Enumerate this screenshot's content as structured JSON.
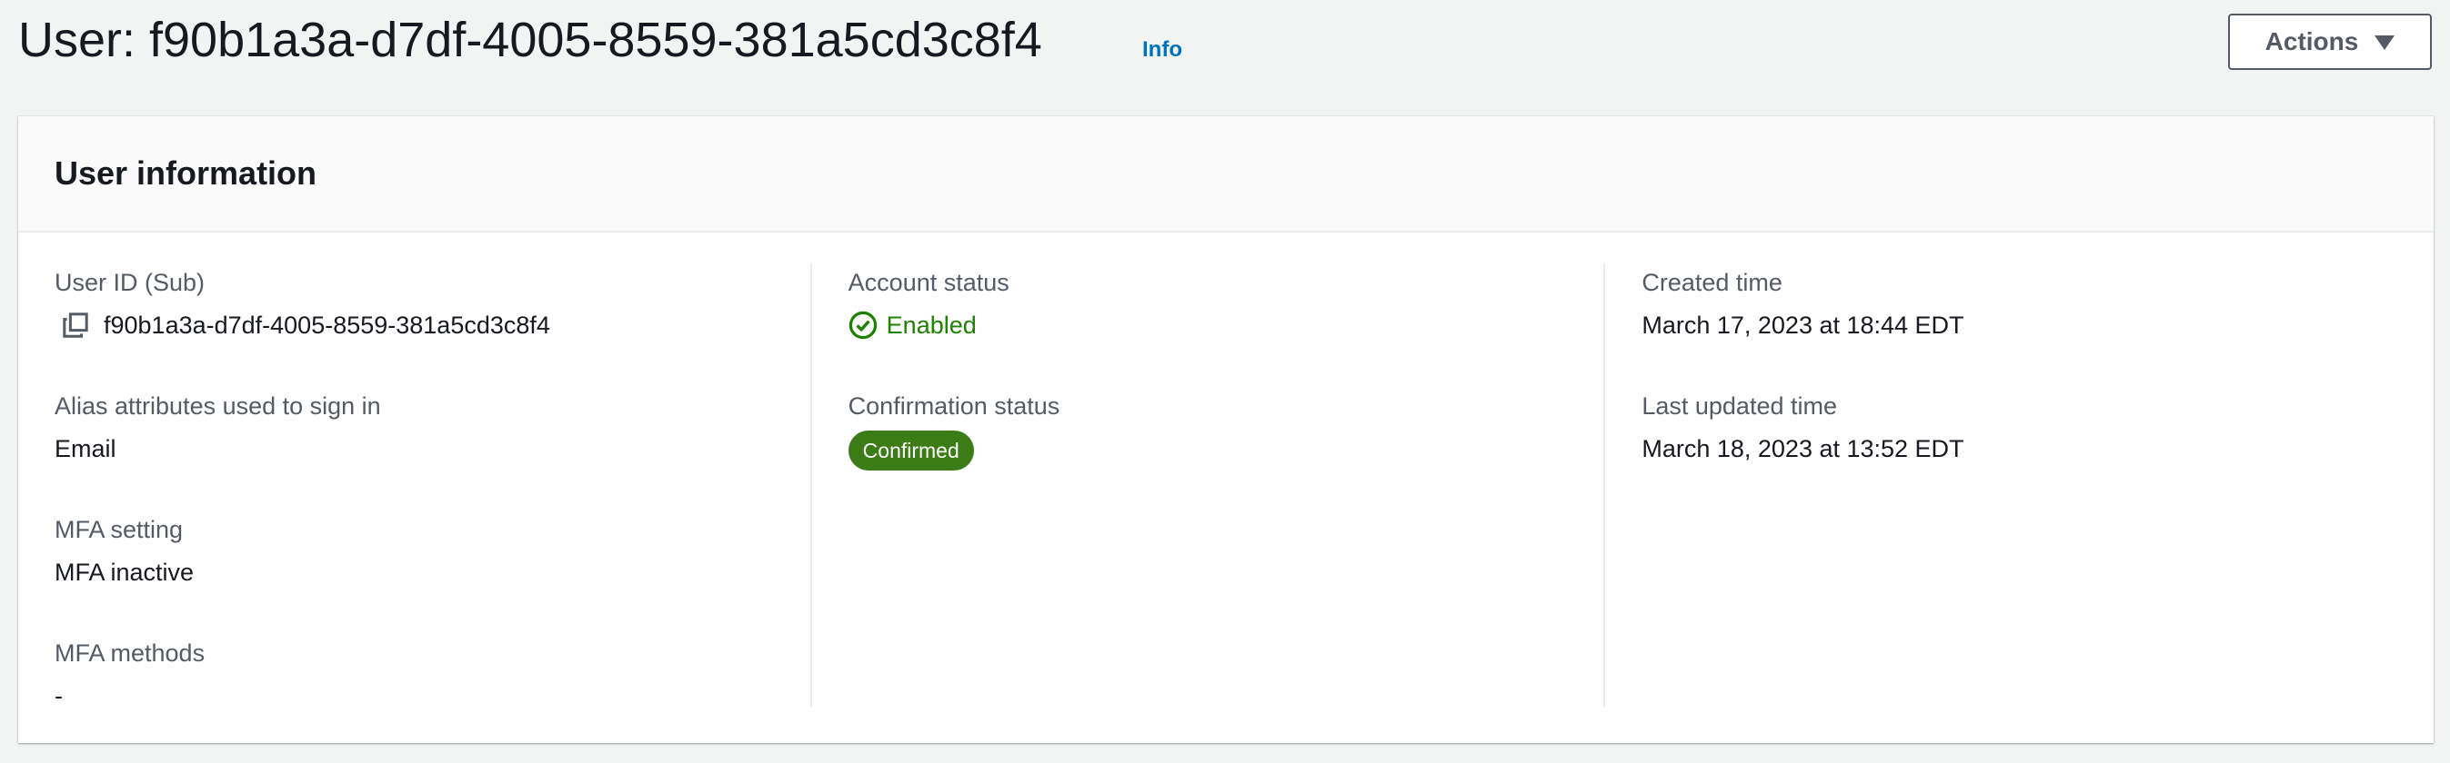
{
  "header": {
    "title": "User: f90b1a3a-d7df-4005-8559-381a5cd3c8f4",
    "info_link": "Info",
    "actions_label": "Actions"
  },
  "card": {
    "title": "User information",
    "columns": [
      {
        "fields": [
          {
            "label": "User ID (Sub)",
            "value": "f90b1a3a-d7df-4005-8559-381a5cd3c8f4",
            "icon": "copy-icon"
          },
          {
            "label": "Alias attributes used to sign in",
            "value": "Email"
          },
          {
            "label": "MFA setting",
            "value": "MFA inactive"
          },
          {
            "label": "MFA methods",
            "value": "-"
          }
        ]
      },
      {
        "fields": [
          {
            "label": "Account status",
            "value": "Enabled",
            "icon": "check-circle-icon",
            "color": "#1d8102"
          },
          {
            "label": "Confirmation status",
            "value": "Confirmed",
            "badge_color": "#3b7c16"
          }
        ]
      },
      {
        "fields": [
          {
            "label": "Created time",
            "value": "March 17, 2023 at 18:44 EDT"
          },
          {
            "label": "Last updated time",
            "value": "March 18, 2023 at 13:52 EDT"
          }
        ]
      }
    ]
  },
  "colors": {
    "background": "#f2f3f3",
    "link": "#0073bb",
    "success": "#1d8102",
    "badge": "#3b7c16",
    "label": "#545b64"
  }
}
